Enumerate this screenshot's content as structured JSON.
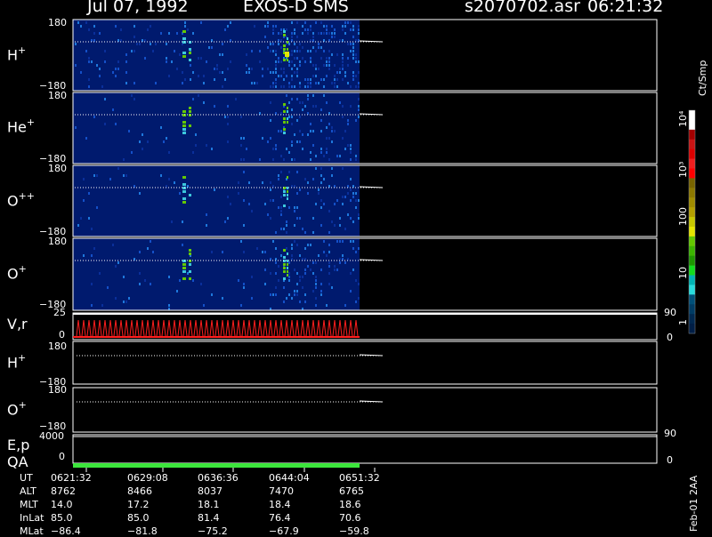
{
  "header": {
    "date": "Jul 07, 1992",
    "mission": "EXOS-D SMS",
    "file": "s2070702.asr",
    "time": "06:21:32"
  },
  "panels": [
    {
      "label_main": "H",
      "label_sup": "+",
      "ytop": "180",
      "ybot": "−180"
    },
    {
      "label_main": "He",
      "label_sup": "+",
      "ytop": "180",
      "ybot": "−180"
    },
    {
      "label_main": "O",
      "label_sup": "++",
      "ytop": "180",
      "ybot": "−180"
    },
    {
      "label_main": "O",
      "label_sup": "+",
      "ytop": "180",
      "ybot": "−180"
    }
  ],
  "vr_panel": {
    "label": "V,r",
    "ytop": "25",
    "ybot": "0",
    "rtop": "90",
    "rbot": "0"
  },
  "att_panels": [
    {
      "label_main": "H",
      "label_sup": "+",
      "ytop": "180",
      "ybot": "−180"
    },
    {
      "label_main": "O",
      "label_sup": "+",
      "ytop": "180",
      "ybot": "−180"
    }
  ],
  "ep_panel": {
    "label": "E,p",
    "ytop": "4000",
    "rtop": "90"
  },
  "qa_panel": {
    "label": "QA",
    "ytick": "0",
    "rtick": "0"
  },
  "colorbar": {
    "unit": "Ct/Smp",
    "ticks": [
      "10⁴",
      "10³",
      "100",
      "10",
      "1"
    ],
    "colors": [
      "#ffffff",
      "#ffffff",
      "#a40000",
      "#c81414",
      "#dc0000",
      "#f01e1e",
      "#ff0000",
      "#786400",
      "#8c7800",
      "#a08c00",
      "#b4a000",
      "#c8c800",
      "#e6e600",
      "#64c800",
      "#3cb400",
      "#1e9600",
      "#14dc1e",
      "#00b4b4",
      "#28dcdc",
      "#005078",
      "#003c64",
      "#002850",
      "#001e46"
    ]
  },
  "footer": {
    "rows": [
      {
        "label": "UT",
        "values": [
          "0621:32",
          "0629:08",
          "0636:36",
          "0644:04",
          "0651:32"
        ]
      },
      {
        "label": "ALT",
        "values": [
          "8762",
          "8466",
          "8037",
          "7470",
          "6765"
        ]
      },
      {
        "label": "MLT",
        "values": [
          "14.0",
          "17.2",
          "18.1",
          "18.4",
          "18.6"
        ]
      },
      {
        "label": "InLat",
        "values": [
          "85.0",
          "85.0",
          "81.4",
          "76.4",
          "70.6"
        ]
      },
      {
        "label": "MLat",
        "values": [
          "−86.4",
          "−81.8",
          "−75.2",
          "−67.9",
          "−59.8"
        ]
      }
    ],
    "stamp": "Feb-01 2AA"
  },
  "chart_data": {
    "type": "heatmap",
    "x_ticks": [
      "0621:32",
      "0629:08",
      "0636:36",
      "0644:04",
      "0651:32"
    ],
    "ion_panels": [
      "H+",
      "He+",
      "O++",
      "O+"
    ],
    "y_range": [
      -180,
      180
    ],
    "color_scale": "log",
    "color_range": [
      1,
      10000
    ],
    "data_extent_fraction": 0.5
  }
}
